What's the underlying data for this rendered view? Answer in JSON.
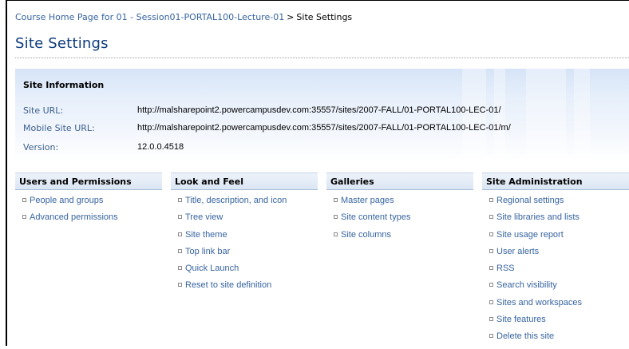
{
  "breadcrumb": {
    "course_home": "Course Home Page for 01 - Session01-PORTAL100-Lecture-01",
    "separator": ">",
    "current": "Site Settings"
  },
  "page_title": "Site Settings",
  "site_information": {
    "heading": "Site Information",
    "site_url_label": "Site URL:",
    "site_url_value": "http://malsharepoint2.powercampusdev.com:35557/sites/2007-FALL/01-PORTAL100-LEC-01/",
    "mobile_url_label": "Mobile Site URL:",
    "mobile_url_value": "http://malsharepoint2.powercampusdev.com:35557/sites/2007-FALL/01-PORTAL100-LEC-01/m/",
    "version_label": "Version:",
    "version_value": "12.0.0.4518"
  },
  "sections": [
    {
      "title": "Users and Permissions",
      "items": [
        "People and groups",
        "Advanced permissions"
      ]
    },
    {
      "title": "Look and Feel",
      "items": [
        "Title, description, and icon",
        "Tree view",
        "Site theme",
        "Top link bar",
        "Quick Launch",
        "Reset to site definition"
      ]
    },
    {
      "title": "Galleries",
      "items": [
        "Master pages",
        "Site content types",
        "Site columns"
      ]
    },
    {
      "title": "Site Administration",
      "items": [
        "Regional settings",
        "Site libraries and lists",
        "Site usage report",
        "User alerts",
        "RSS",
        "Search visibility",
        "Sites and workspaces",
        "Site features",
        "Delete this site"
      ]
    }
  ],
  "colors": {
    "link": "#3764a0",
    "title": "#0e3c7d",
    "header_band": "#dbe6f4"
  }
}
